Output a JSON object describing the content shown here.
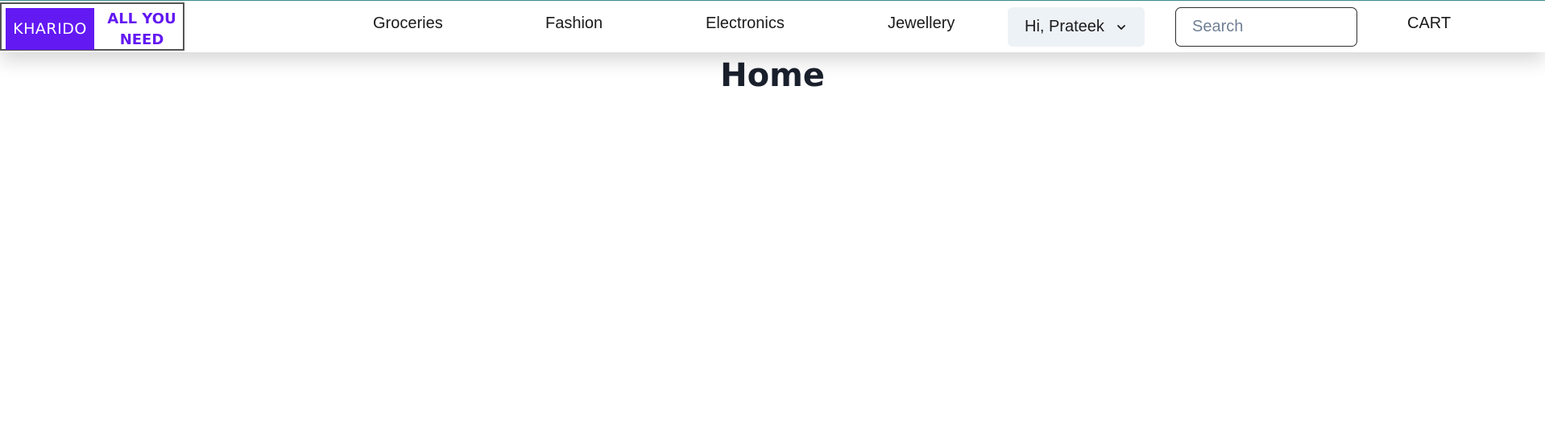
{
  "brand": {
    "logo_text": "KHARIDO",
    "tagline_line1": "ALL YOU",
    "tagline_line2": "NEED",
    "accent_color": "#6319f2"
  },
  "nav": {
    "items": [
      {
        "label": "Groceries"
      },
      {
        "label": "Fashion"
      },
      {
        "label": "Electronics"
      },
      {
        "label": "Jewellery"
      }
    ],
    "user_menu": {
      "label": "Hi, Prateek",
      "icon": "chevron-down-icon"
    },
    "search": {
      "placeholder": "Search",
      "value": ""
    },
    "cart_label": "CART"
  },
  "main": {
    "title": "Home"
  }
}
